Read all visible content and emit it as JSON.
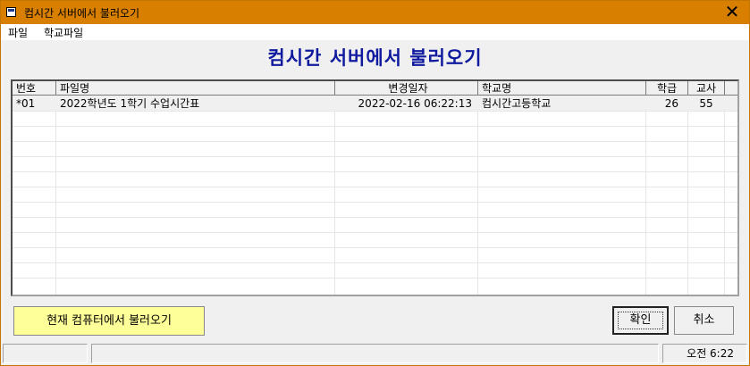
{
  "window": {
    "title": "컴시간 서버에서 불러오기",
    "close_glyph": "✕",
    "icon": "window-app-icon"
  },
  "menu": {
    "items": [
      "파일",
      "학교파일"
    ]
  },
  "heading": "컴시간 서버에서 불러오기",
  "table": {
    "columns": [
      "번호",
      "파일명",
      "변경일자",
      "학교명",
      "학급",
      "교사"
    ],
    "rows": [
      [
        "*01",
        "2022학년도 1학기 수업시간표",
        "2022-02-16 06:22:13",
        "컴시간고등학교",
        "26",
        "55"
      ]
    ]
  },
  "buttons": {
    "local_load": "현재 컴퓨터에서 불러오기",
    "ok": "확인",
    "cancel": "취소"
  },
  "status": {
    "time": "오전 6:22"
  },
  "colors": {
    "titlebar": "#d87f00",
    "heading": "#0f1a9e",
    "local_button": "#ffff99"
  }
}
